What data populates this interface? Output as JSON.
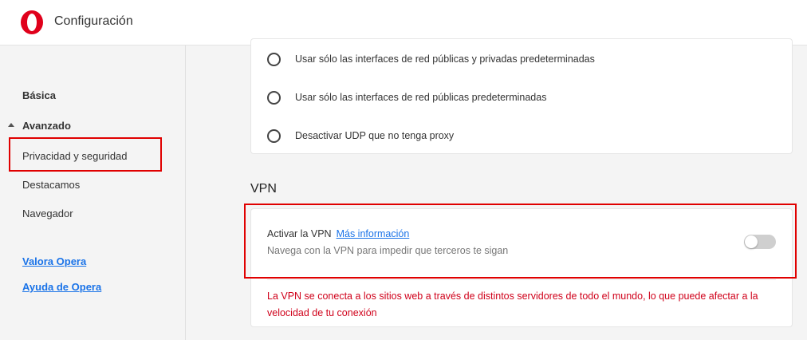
{
  "header": {
    "title": "Configuración"
  },
  "sidebar": {
    "items": [
      {
        "label": "Básica"
      },
      {
        "label": "Avanzado"
      },
      {
        "label": "Privacidad y seguridad"
      },
      {
        "label": "Destacamos"
      },
      {
        "label": "Navegador"
      }
    ],
    "links": [
      {
        "label": "Valora Opera"
      },
      {
        "label": "Ayuda de Opera"
      }
    ]
  },
  "webrtc_options": [
    {
      "label": "Usar sólo las interfaces de red públicas y privadas predeterminadas",
      "selected": false
    },
    {
      "label": "Usar sólo las interfaces de red públicas predeterminadas",
      "selected": false
    },
    {
      "label": "Desactivar UDP que no tenga proxy",
      "selected": false
    }
  ],
  "vpn": {
    "section_title": "VPN",
    "toggle_label": "Activar la VPN",
    "more_info": "Más información",
    "description": "Navega con la VPN para impedir que terceros te sigan",
    "enabled": false,
    "warning": "La VPN se conecta a los sitios web a través de distintos servidores de todo el mundo, lo que puede afectar a la velocidad de tu conexión"
  },
  "colors": {
    "accent": "#1a73e8",
    "warning": "#d0021b",
    "highlight": "#e00000",
    "brand": "#e0001b"
  },
  "icons": {
    "logo": "opera-logo-icon",
    "collapse": "caret-up-icon"
  }
}
